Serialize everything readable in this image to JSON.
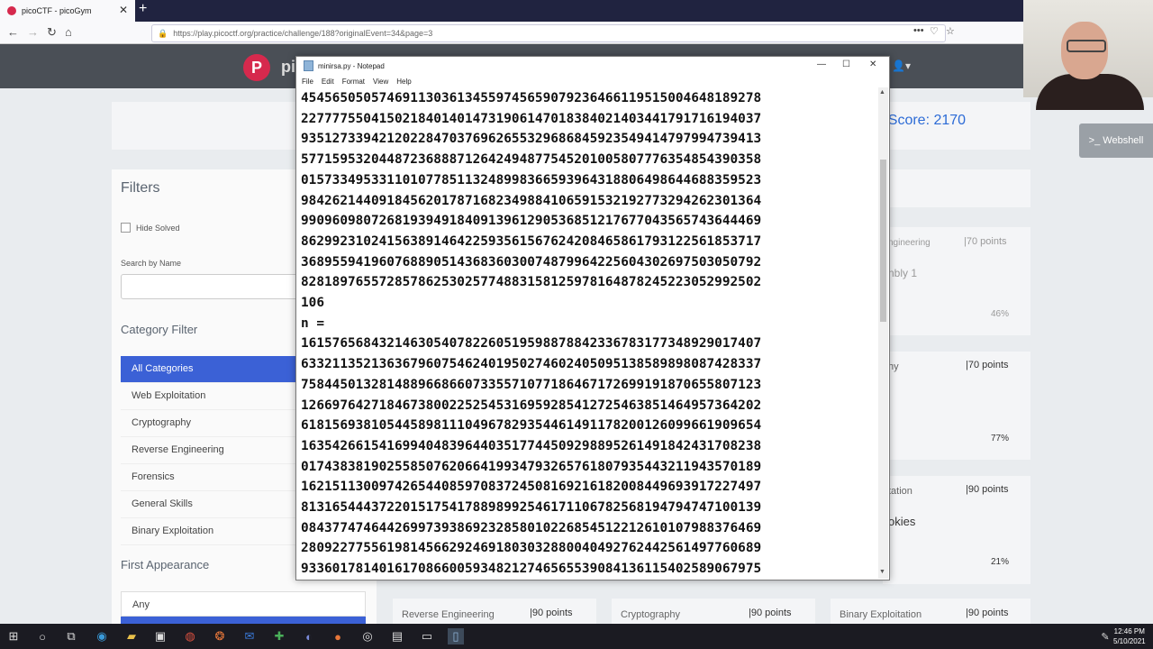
{
  "browser": {
    "tab_title": "picoCTF - picoGym",
    "url": "https://play.picoctf.org/practice/challenge/188?originalEvent=34&page=3",
    "new_tab": "+",
    "tab_close": "✕"
  },
  "site": {
    "logo_letter": "P",
    "logo_text": "pi",
    "score": "ym Score: 2170",
    "webshell": ">_ Webshell",
    "user_icon": "👤▾"
  },
  "filters": {
    "title": "Filters",
    "hide_solved": "Hide Solved",
    "search_label": "Search by Name",
    "category_title": "Category Filter",
    "categories": [
      {
        "label": "All Categories"
      },
      {
        "label": "Web Exploitation"
      },
      {
        "label": "Cryptography"
      },
      {
        "label": "Reverse Engineering"
      },
      {
        "label": "Forensics"
      },
      {
        "label": "General Skills"
      },
      {
        "label": "Binary Exploitation"
      }
    ],
    "first_appearance_title": "First Appearance",
    "first_appearance_value": "Any"
  },
  "cards": {
    "c1_cat": "ngineering",
    "c1_pts": "|70 points",
    "c1_name": "nbly 1",
    "c1_pct": "46%",
    "c2_cat": "hy",
    "c2_pts": "|70 points",
    "c2_pct": "77%",
    "c3_cat": "tation",
    "c3_pts": "|90 points",
    "c3_name": "okies",
    "c3_pct": "21%",
    "b1_cat": "Reverse Engineering",
    "b1_pts": "|90 points",
    "b2_cat": "Cryptography",
    "b2_pts": "|90 points",
    "b3_cat": "Binary Exploitation",
    "b3_pts": "|90 points"
  },
  "notepad": {
    "title": "minirsa.py - Notepad",
    "menu": [
      "File",
      "Edit",
      "Format",
      "View",
      "Help"
    ],
    "content": "45456505057469113036134559745659079236466119515004648189278\n22777755041502184014014731906147018384021403441791716194037\n93512733942120228470376962655329686845923549414797994739413\n57715953204487236888712642494877545201005807776354854390358\n01573349533110107785113248998366593964318806498644688359523\n98426214409184562017871682349884106591532192773294262301364\n99096098072681939491840913961290536851217677043565743644469\n86299231024156389146422593561567624208465861793122561853717\n36895594196076889051436836030074879964225604302697503050792\n82818976557285786253025774883158125978164878245223052992502\n106\nn =\n16157656843214630540782260519598878842336783177348929017407\n63321135213636796075462401950274602405095138589898087428337\n75844501328148896686607335571077186467172699191870655807123\n12669764271846738002252545316959285412725463851464957364202\n61815693810544589811104967829354461491178200126099661909654\n16354266154169940483964403517744509298895261491842431708238\n01743838190255850762066419934793265761807935443211943570189\n16215113009742654408597083724508169216182008449693917227497\n81316544437220151754178898992546171106782568194794747100139\n08437747464426997393869232858010226854512212610107988376469\n28092277556198145662924691803032880040492762442561497760689\n93360178140161708660059348212746565539084136115402589067975"
  },
  "taskbar": {
    "time": "12:46 PM",
    "date": "5/10/2021"
  }
}
